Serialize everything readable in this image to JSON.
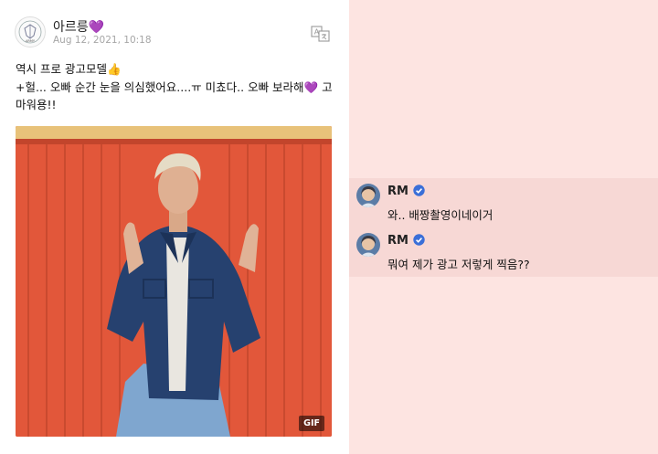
{
  "post": {
    "user_name": "아르릉",
    "heart": "💜",
    "date": "Aug 12, 2021, 10:18",
    "body_lines": [
      "역시 프로 광고모델👍",
      "+헐... 오빠 순간 눈을 의심했어요....ㅠ 미쵸다.. 오빠 보라해💜 고",
      "마워용!!"
    ],
    "media_badge": "GIF",
    "icons": {
      "avatar": "army-logo-icon",
      "translate": "translate-icon"
    }
  },
  "comments": [
    {
      "author": "RM",
      "text": "와.. 배짱촬영이네이거",
      "verified": true
    },
    {
      "author": "RM",
      "text": "뭐여 제가 광고 저렇게 찍음??",
      "verified": true
    }
  ],
  "colors": {
    "background": "#fde4e1",
    "comment_band": "#f7d8d5",
    "verified": "#3a6fd8",
    "heart": "#a64cf0"
  }
}
